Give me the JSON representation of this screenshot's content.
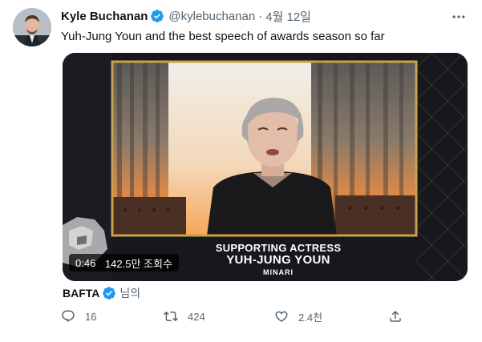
{
  "tweet": {
    "author_name": "Kyle Buchanan",
    "handle": "@kylebuchanan",
    "separator": "·",
    "date": "4월 12일",
    "text": "Yuh-Jung Youn and the best speech of awards season so far"
  },
  "video": {
    "caption_line1": "SUPPORTING ACTRESS",
    "caption_line2": "YUH-JUNG YOUN",
    "caption_line3": "MINARI",
    "duration": "0:46",
    "views": "142.5만 조회수"
  },
  "attribution": {
    "source": "BAFTA",
    "suffix": "님의"
  },
  "actions": {
    "reply_count": "16",
    "retweet_count": "424",
    "like_count": "2.4천"
  },
  "colors": {
    "verified": "#1d9bf0",
    "secondary_text": "#536471",
    "frame_gold": "#c9a24a"
  },
  "icons": {
    "verified": "verified-badge-icon",
    "more": "more-horizontal-icon",
    "reply": "reply-icon",
    "retweet": "retweet-icon",
    "like": "heart-icon",
    "share": "share-icon"
  }
}
